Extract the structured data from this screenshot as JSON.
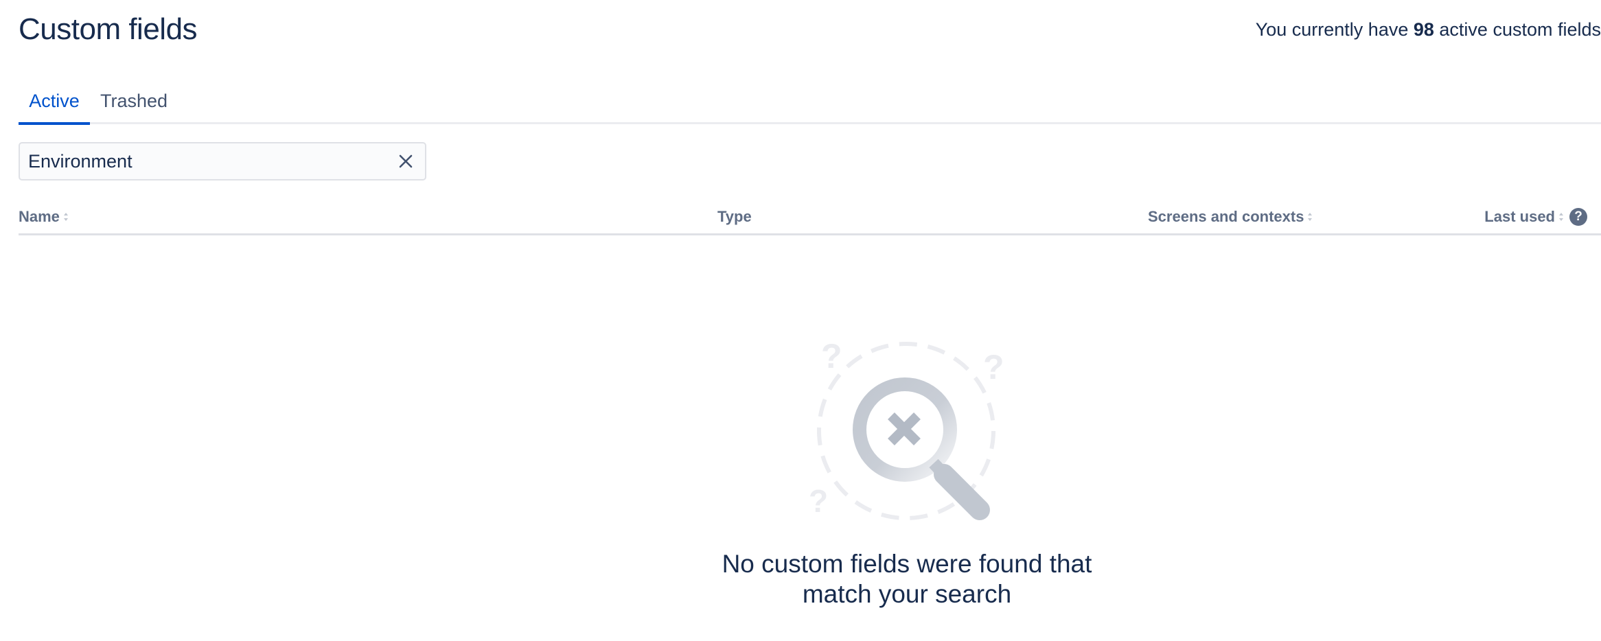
{
  "header": {
    "title": "Custom fields",
    "summary_prefix": "You currently have ",
    "summary_count": "98",
    "summary_suffix": " active custom fields"
  },
  "tabs": [
    {
      "label": "Active",
      "selected": true
    },
    {
      "label": "Trashed",
      "selected": false
    }
  ],
  "search": {
    "value": "Environment",
    "clear_icon": "close-icon"
  },
  "table": {
    "columns": [
      {
        "label": "Name",
        "sortable": true
      },
      {
        "label": "Type",
        "sortable": false
      },
      {
        "label": "Screens and contexts",
        "sortable": true
      },
      {
        "label": "Last used",
        "sortable": true,
        "help": "?"
      }
    ]
  },
  "empty_state": {
    "illustration": "magnifier-no-results-icon",
    "message_line1": "No custom fields were found that",
    "message_line2": "match your search"
  },
  "colors": {
    "primary": "#0052cc",
    "text": "#172b4d",
    "subtle_text": "#5e6c84",
    "border": "#dfe1e6"
  }
}
